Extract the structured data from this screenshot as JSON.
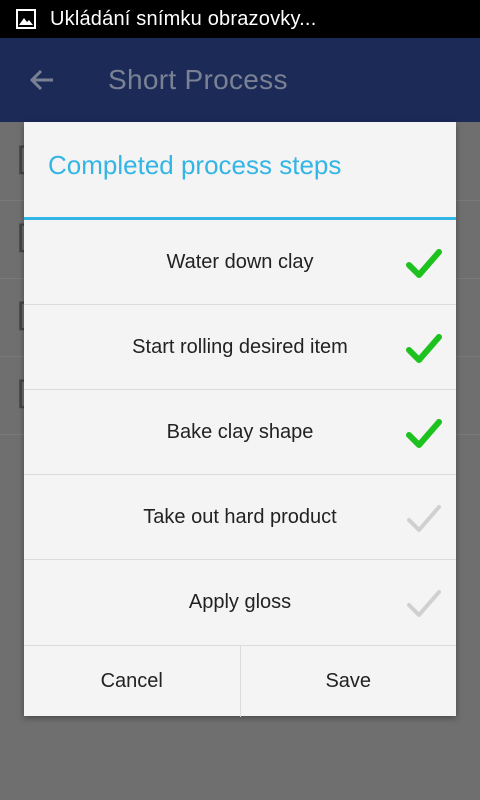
{
  "status_bar": {
    "icon": "image-icon",
    "text": "Ukládání snímku obrazovky..."
  },
  "app_bar": {
    "back_icon": "arrow-left-icon",
    "title": "Short Process"
  },
  "background_rows": [
    "[",
    "[",
    "[",
    "["
  ],
  "dialog": {
    "title": "Completed process steps",
    "accent_color": "#33b5e5",
    "steps": [
      {
        "label": "Water down clay",
        "checked": true
      },
      {
        "label": "Start rolling desired item",
        "checked": true
      },
      {
        "label": "Bake clay shape",
        "checked": true
      },
      {
        "label": "Take out hard product",
        "checked": false
      },
      {
        "label": "Apply gloss",
        "checked": false
      }
    ],
    "check_color_on": "#1ec21e",
    "check_color_off": "#d0d0d0",
    "cancel_label": "Cancel",
    "save_label": "Save"
  }
}
